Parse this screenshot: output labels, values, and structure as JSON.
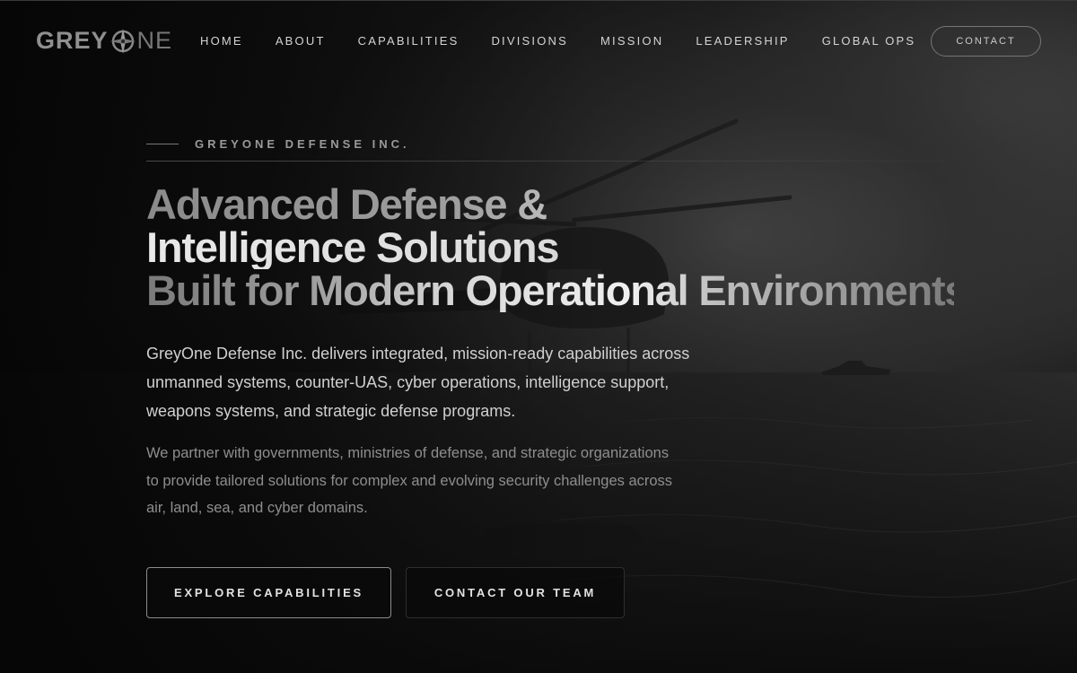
{
  "brand": {
    "name_a": "GREY",
    "name_b": "NE",
    "logo_icon": "compass-icon"
  },
  "nav": {
    "items": [
      {
        "label": "HOME"
      },
      {
        "label": "ABOUT"
      },
      {
        "label": "CAPABILITIES"
      },
      {
        "label": "DIVISIONS"
      },
      {
        "label": "MISSION"
      },
      {
        "label": "LEADERSHIP"
      },
      {
        "label": "GLOBAL OPS"
      }
    ],
    "contact_label": "CONTACT"
  },
  "hero": {
    "eyebrow": "GREYONE DEFENSE INC.",
    "headline": [
      "Advanced Defense &",
      "Intelligence Solutions",
      "Built for Modern Operational Environments"
    ],
    "intro": "GreyOne Defense Inc. delivers integrated, mission-ready capabilities across unmanned systems, counter-UAS, cyber operations, intelligence support, weapons systems, and strategic defense programs.",
    "secondary": "We partner with governments, ministries of defense, and strategic organizations to provide tailored solutions for complex and evolving security challenges across air, land, sea, and cyber domains.",
    "cta_primary": "EXPLORE CAPABILITIES",
    "cta_secondary": "CONTACT OUR TEAM"
  },
  "colors": {
    "background": "#070707",
    "text": "#d0d0d0",
    "muted": "#8e8e8e",
    "border": "#8c8c8c"
  }
}
